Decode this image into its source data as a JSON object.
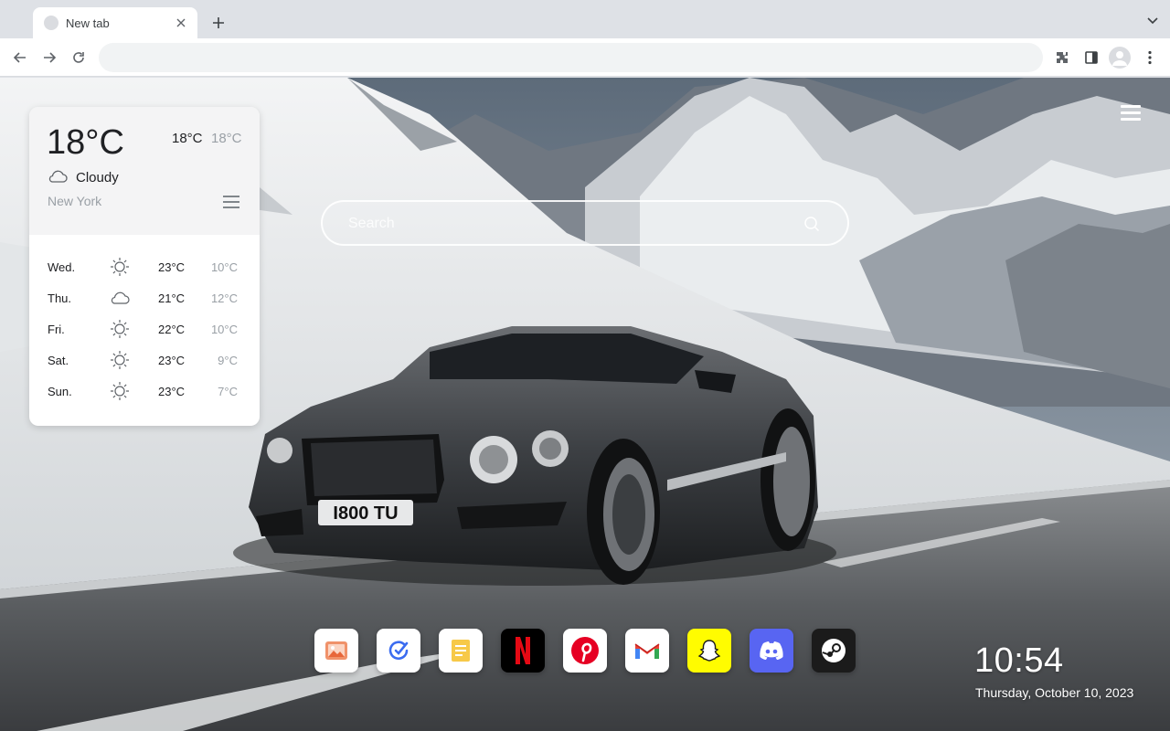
{
  "browser": {
    "tab_title": "New tab",
    "omnibox_value": "",
    "omnibox_placeholder": ""
  },
  "weather": {
    "current_temp": "18°C",
    "high": "18°C",
    "low": "18°C",
    "condition": "Cloudy",
    "condition_icon": "cloud-icon",
    "city": "New York",
    "forecast": [
      {
        "day": "Wed.",
        "icon": "sun-icon",
        "high": "23°C",
        "low": "10°C"
      },
      {
        "day": "Thu.",
        "icon": "cloud-icon",
        "high": "21°C",
        "low": "12°C"
      },
      {
        "day": "Fri.",
        "icon": "sun-icon",
        "high": "22°C",
        "low": "10°C"
      },
      {
        "day": "Sat.",
        "icon": "sun-icon",
        "high": "23°C",
        "low": "9°C"
      },
      {
        "day": "Sun.",
        "icon": "sun-icon",
        "high": "23°C",
        "low": "7°C"
      }
    ]
  },
  "search": {
    "placeholder": "Search"
  },
  "dock": [
    {
      "name": "photos-app",
      "icon": "image-icon",
      "color": "#ffffff"
    },
    {
      "name": "tasks-app",
      "icon": "check-edit-icon",
      "color": "#ffffff"
    },
    {
      "name": "notes-app",
      "icon": "notes-icon",
      "color": "#ffffff"
    },
    {
      "name": "netflix-app",
      "icon": "netflix-icon",
      "color": "#000000"
    },
    {
      "name": "pinterest-app",
      "icon": "pinterest-icon",
      "color": "#ffffff"
    },
    {
      "name": "gmail-app",
      "icon": "gmail-icon",
      "color": "#ffffff"
    },
    {
      "name": "snapchat-app",
      "icon": "snapchat-icon",
      "color": "#fffc00"
    },
    {
      "name": "discord-app",
      "icon": "discord-icon",
      "color": "#5865f2"
    },
    {
      "name": "steam-app",
      "icon": "steam-icon",
      "color": "#1b1b1b"
    }
  ],
  "clock": {
    "time": "10:54",
    "date": "Thursday, October 10, 2023"
  },
  "plate_text": "I800 TU"
}
